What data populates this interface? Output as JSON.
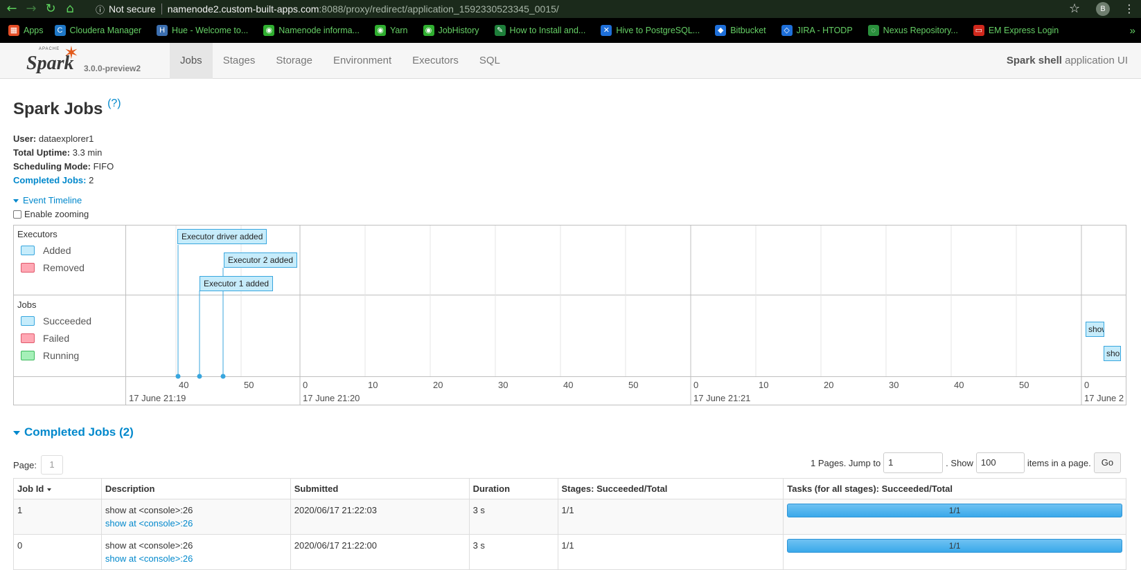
{
  "browser": {
    "security_label": "Not secure",
    "url_host": "namenode2.custom-built-apps.com",
    "url_path": ":8088/proxy/redirect/application_1592330523345_0015/",
    "profile_letter": "B"
  },
  "bookmarks": [
    {
      "label": "Apps",
      "icon": "apps-grid-icon",
      "color": "#e44d26"
    },
    {
      "label": "Cloudera Manager",
      "icon": "cloudera-icon",
      "color": "#1f78c8"
    },
    {
      "label": "Hue - Welcome to...",
      "icon": "hue-icon",
      "color": "#3c6fb0"
    },
    {
      "label": "Namenode informa...",
      "icon": "globe-icon",
      "color": "#2fae2f"
    },
    {
      "label": "Yarn",
      "icon": "globe-icon",
      "color": "#2fae2f"
    },
    {
      "label": "JobHistory",
      "icon": "globe-icon",
      "color": "#2fae2f"
    },
    {
      "label": "How to Install and...",
      "icon": "leaf-icon",
      "color": "#1e7f3a"
    },
    {
      "label": "Hive to PostgreSQL...",
      "icon": "dropbox-icon",
      "color": "#1e6fd9"
    },
    {
      "label": "Bitbucket",
      "icon": "bitbucket-icon",
      "color": "#1e6fd9"
    },
    {
      "label": "JIRA - HTODP",
      "icon": "jira-icon",
      "color": "#1e6fd9"
    },
    {
      "label": "Nexus Repository...",
      "icon": "nexus-icon",
      "color": "#2a8f3c"
    },
    {
      "label": "EM Express Login",
      "icon": "oracle-icon",
      "color": "#d0281c"
    }
  ],
  "spark": {
    "version": "3.0.0-preview2",
    "tabs": [
      "Jobs",
      "Stages",
      "Storage",
      "Environment",
      "Executors",
      "SQL"
    ],
    "active_tab": "Jobs",
    "app_name": "Spark shell",
    "app_suffix": " application UI"
  },
  "page": {
    "title": "Spark Jobs",
    "help": "(?)",
    "user_label": "User:",
    "user": "dataexplorer1",
    "uptime_label": "Total Uptime:",
    "uptime": "3.3 min",
    "sched_label": "Scheduling Mode:",
    "sched": "FIFO",
    "completed_label": "Completed Jobs:",
    "completed": "2"
  },
  "timeline": {
    "toggle": "Event Timeline",
    "zoom_label": "Enable zooming",
    "exec_group": "Executors",
    "exec_legend": [
      "Added",
      "Removed"
    ],
    "jobs_group": "Jobs",
    "jobs_legend": [
      "Succeeded",
      "Failed",
      "Running"
    ],
    "events": [
      "Executor driver added",
      "Executor 2 added",
      "Executor 1 added"
    ],
    "jobs": [
      "show",
      "sho"
    ],
    "ticks_minor": [
      "40",
      "50",
      "0",
      "10",
      "20",
      "30",
      "40",
      "50",
      "0",
      "10",
      "20",
      "30",
      "40",
      "50",
      "0"
    ],
    "ticks_major": [
      "17 June 21:19",
      "17 June 21:20",
      "17 June 21:21",
      "17 June 2"
    ],
    "colors": {
      "added": "#c6ecfb",
      "removed": "#ffa8b4",
      "running": "#a5f0b8",
      "border": "#38a6de"
    }
  },
  "completed_jobs": {
    "title": "Completed Jobs (2)",
    "page_label": "Page:",
    "page_value": "1",
    "pages_text": "1 Pages. Jump to",
    "jump_value": "1",
    "show_text": ". Show",
    "show_value": "100",
    "items_text": "items in a page.",
    "go": "Go",
    "headers": [
      "Job Id",
      "Description",
      "Submitted",
      "Duration",
      "Stages: Succeeded/Total",
      "Tasks (for all stages): Succeeded/Total"
    ],
    "rows": [
      {
        "id": "1",
        "desc": "show at <console>:26",
        "desc_link": "show at <console>:26",
        "submitted": "2020/06/17 21:22:03",
        "duration": "3 s",
        "stages": "1/1",
        "tasks": "1/1",
        "tasks_fraction": 1.0
      },
      {
        "id": "0",
        "desc": "show at <console>:26",
        "desc_link": "show at <console>:26",
        "submitted": "2020/06/17 21:22:00",
        "duration": "3 s",
        "stages": "1/1",
        "tasks": "1/1",
        "tasks_fraction": 1.0
      }
    ]
  }
}
